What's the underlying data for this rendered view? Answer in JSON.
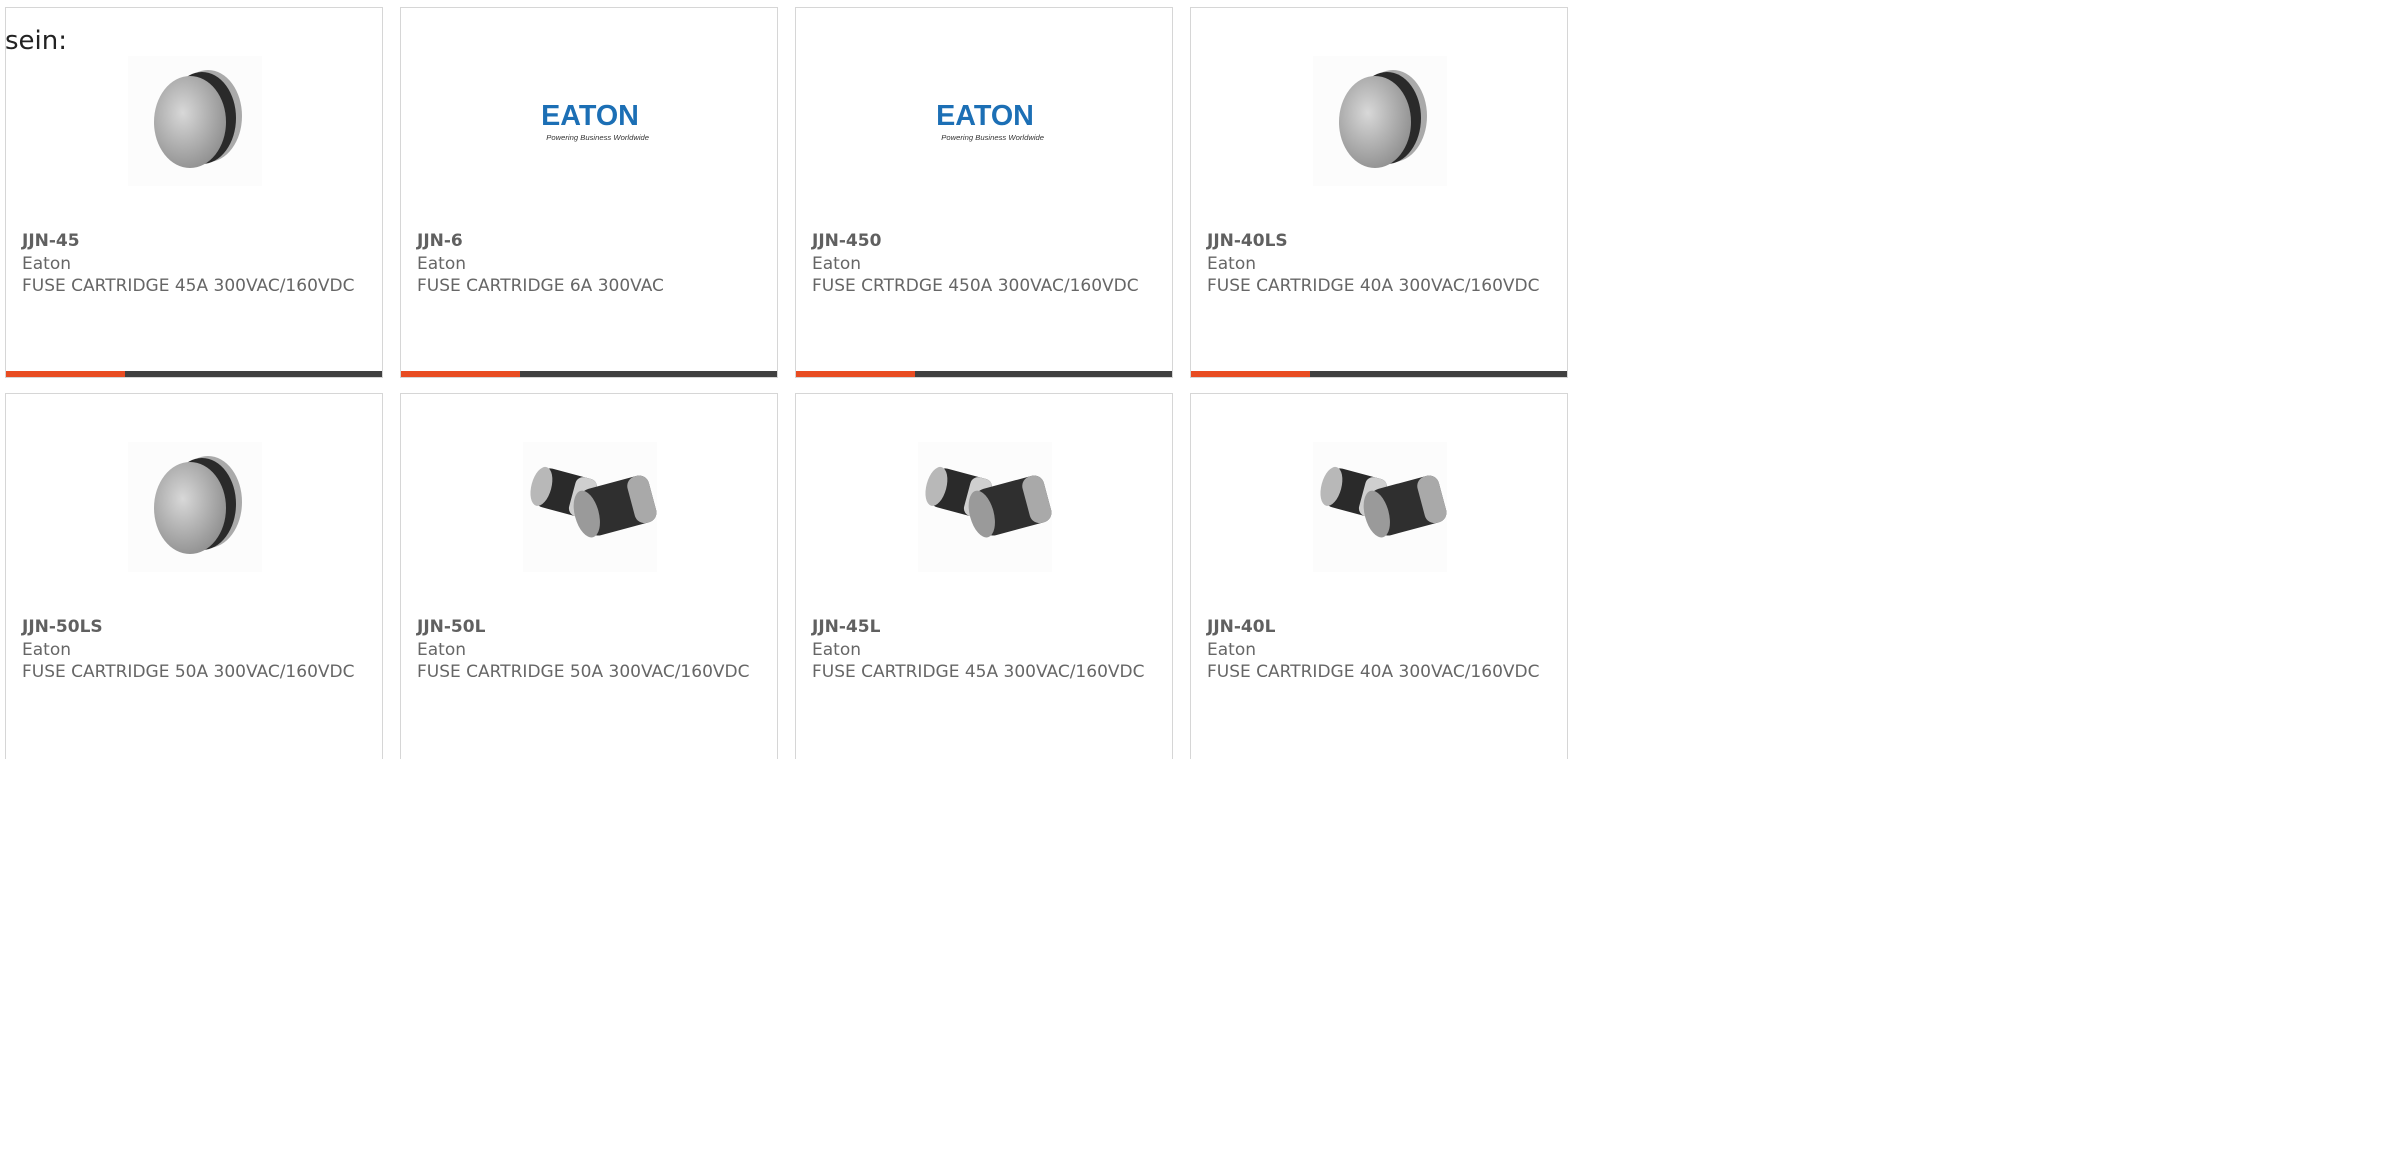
{
  "intro_text": "sein:",
  "colors": {
    "accent": "#e84c22",
    "bar": "#404040",
    "eaton_blue": "#1c6fb5"
  },
  "rows": [
    [
      {
        "pn": "JJN-45",
        "mfr": "Eaton",
        "desc": "FUSE CARTRIDGE 45A 300VAC/160VDC",
        "image": "puck-fuse-icon"
      },
      {
        "pn": "JJN-6",
        "mfr": "Eaton",
        "desc": "FUSE CARTRIDGE 6A 300VAC",
        "image": "eaton-logo",
        "logo_text": "EATON",
        "logo_tagline": "Powering Business Worldwide"
      },
      {
        "pn": "JJN-450",
        "mfr": "Eaton",
        "desc": "FUSE CRTRDGE 450A 300VAC/160VDC",
        "image": "eaton-logo",
        "logo_text": "EATON",
        "logo_tagline": "Powering Business Worldwide"
      },
      {
        "pn": "JJN-40LS",
        "mfr": "Eaton",
        "desc": "FUSE CARTRIDGE 40A 300VAC/160VDC",
        "image": "puck-fuse-icon"
      }
    ],
    [
      {
        "pn": "JJN-50LS",
        "mfr": "Eaton",
        "desc": "FUSE CARTRIDGE 50A 300VAC/160VDC",
        "image": "puck-fuse-icon"
      },
      {
        "pn": "JJN-50L",
        "mfr": "Eaton",
        "desc": "FUSE CARTRIDGE 50A 300VAC/160VDC",
        "image": "cylinder-fuse-icon"
      },
      {
        "pn": "JJN-45L",
        "mfr": "Eaton",
        "desc": "FUSE CARTRIDGE 45A 300VAC/160VDC",
        "image": "cylinder-fuse-icon"
      },
      {
        "pn": "JJN-40L",
        "mfr": "Eaton",
        "desc": "FUSE CARTRIDGE 40A 300VAC/160VDC",
        "image": "cylinder-fuse-icon"
      }
    ]
  ]
}
